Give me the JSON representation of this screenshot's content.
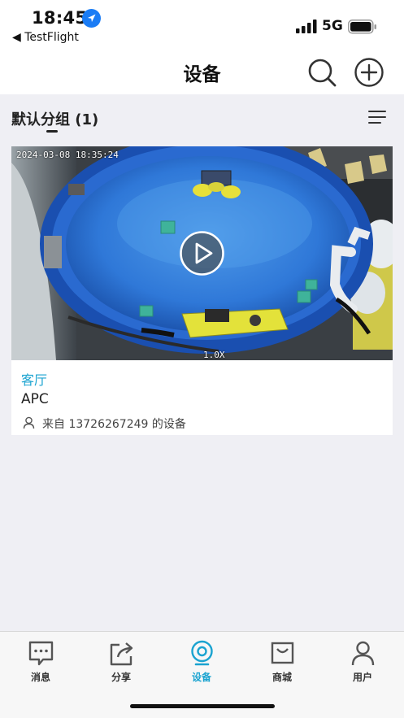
{
  "status_bar": {
    "time": "18:45",
    "back_label": "◀ TestFlight",
    "network": "5G"
  },
  "nav": {
    "title": "设备",
    "search_icon": "search-icon",
    "add_icon": "add-circle-icon"
  },
  "group": {
    "title": "默认分组 (1)",
    "menu_icon": "list-menu-icon"
  },
  "device": {
    "timestamp": "2024-03-08 18:35:24",
    "zoom": "1.0X",
    "room": "客厅",
    "name": "APC",
    "owner": "来自 13726267249 的设备",
    "play_icon": "play-icon"
  },
  "tabs": [
    {
      "label": "消息",
      "icon": "message-icon",
      "active": false
    },
    {
      "label": "分享",
      "icon": "share-icon",
      "active": false
    },
    {
      "label": "设备",
      "icon": "device-icon",
      "active": true
    },
    {
      "label": "商城",
      "icon": "store-icon",
      "active": false
    },
    {
      "label": "用户",
      "icon": "user-icon",
      "active": false
    }
  ],
  "colors": {
    "accent": "#1aa3d0",
    "background": "#efeff4",
    "card": "#ffffff"
  }
}
